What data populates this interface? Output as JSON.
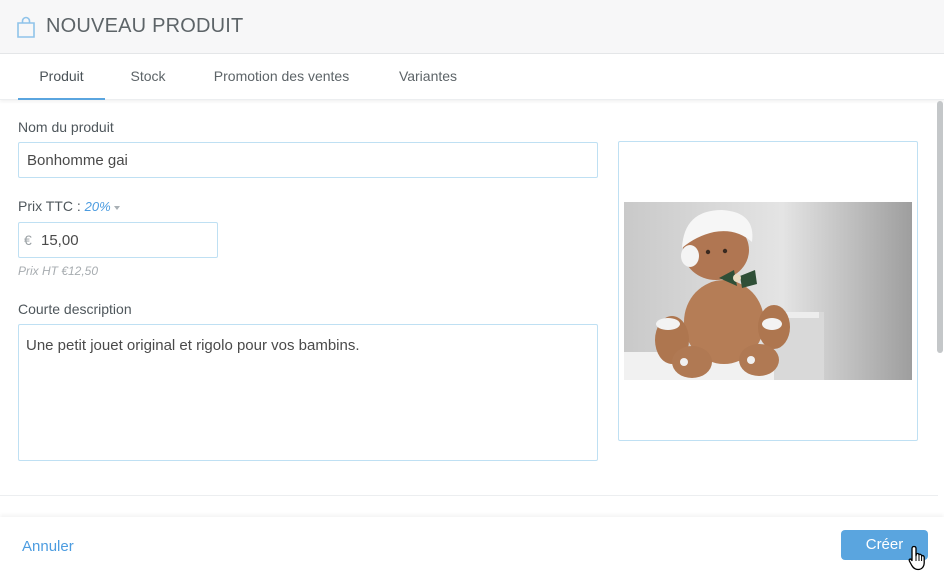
{
  "header": {
    "title": "NOUVEAU PRODUIT",
    "icon": "shopping-bag-icon"
  },
  "tabs": [
    {
      "label": "Produit",
      "active": true
    },
    {
      "label": "Stock",
      "active": false
    },
    {
      "label": "Promotion des ventes",
      "active": false
    },
    {
      "label": "Variantes",
      "active": false
    }
  ],
  "form": {
    "name_label": "Nom du produit",
    "name_value": "Bonhomme gai",
    "price_label": "Prix TTC :",
    "vat_rate": "20%",
    "currency_symbol": "€",
    "price_value": "15,00",
    "price_ht_hint": "Prix HT €12,50",
    "description_label": "Courte description",
    "description_value": "Une petit jouet original et rigolo pour vos bambins."
  },
  "footer": {
    "cancel_label": "Annuler",
    "create_label": "Créer"
  },
  "colors": {
    "accent": "#5aa5df",
    "link": "#4c9ce0",
    "field_border": "#bfe0f3"
  }
}
